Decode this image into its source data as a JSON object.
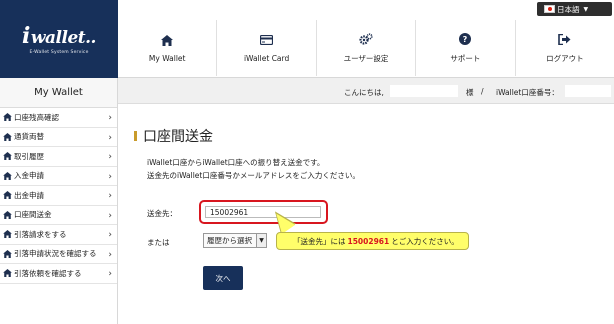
{
  "brand": {
    "logo_text": "wallet..",
    "logo_i": "i",
    "tagline": "E-Wallet System Service"
  },
  "language": {
    "label": "日本語",
    "icon": "japan-flag-icon"
  },
  "nav": [
    {
      "label": "My Wallet",
      "icon": "home-icon"
    },
    {
      "label": "iWallet Card",
      "icon": "card-icon"
    },
    {
      "label": "ユーザー設定",
      "icon": "gears-icon"
    },
    {
      "label": "サポート",
      "icon": "question-circle-icon"
    },
    {
      "label": "ログアウト",
      "icon": "logout-icon"
    }
  ],
  "sidebar": {
    "title": "My Wallet",
    "items": [
      {
        "label": "口座残高確認"
      },
      {
        "label": "通貨両替"
      },
      {
        "label": "取引履歴"
      },
      {
        "label": "入金申請"
      },
      {
        "label": "出金申請"
      },
      {
        "label": "口座間送金"
      },
      {
        "label": "引落請求をする"
      },
      {
        "label": "引落申請状況を確認する"
      },
      {
        "label": "引落依頼を確認する"
      }
    ]
  },
  "greeting": {
    "hello": "こんにちは,",
    "honorific": "様",
    "separator": "/",
    "account_label": "iWallet口座番号："
  },
  "main": {
    "title": "口座間送金",
    "desc_line1": "iWallet口座からiWallet口座への振り替え送金です。",
    "desc_line2": "送金先のiWallet口座番号かメールアドレスをご入力ください。",
    "to_label": "送金先：",
    "to_value": "15002961",
    "or_label": "または",
    "history_select": "履歴から選択",
    "next_button": "次へ"
  },
  "tooltip": {
    "prefix": "「送金先」には",
    "value": "15002961",
    "suffix": "とご入力ください。"
  },
  "colors": {
    "navy": "#17305a",
    "highlight_red": "#d8161f",
    "tooltip_yellow": "#fffe6a",
    "title_accent": "#c99b2b"
  }
}
